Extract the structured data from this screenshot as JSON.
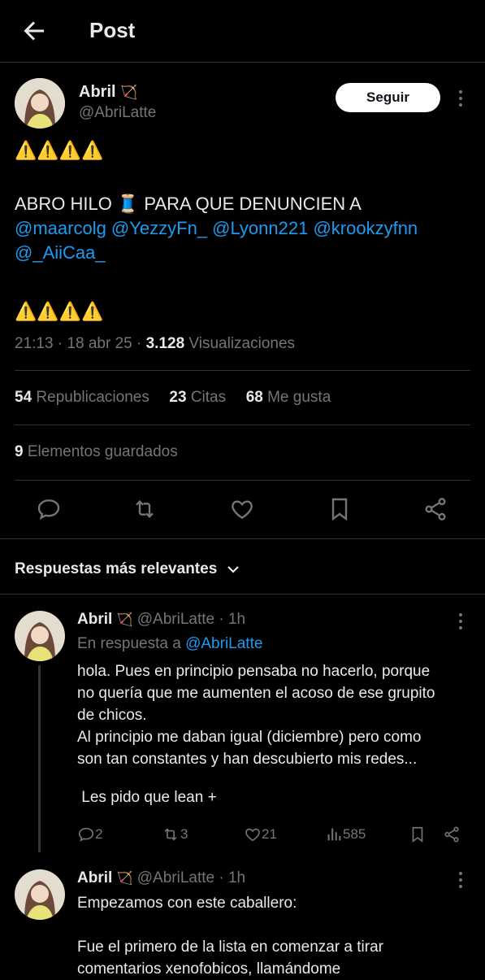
{
  "header": {
    "title": "Post"
  },
  "post": {
    "author_name": "Abril",
    "author_emoji": "🏹",
    "handle": "@AbriLatte",
    "follow_label": "Seguir",
    "warning_line_1": "⚠️⚠️⚠️⚠️",
    "text_prefix": "ABRO HILO 🧵 PARA QUE DENUNCIEN A",
    "mentions_line_1": "@maarcolg @YezzyFn_ @Lyonn221 @krookzyfnn",
    "mentions_line_2": "@_AiiCaa_",
    "warning_line_2": "⚠️⚠️⚠️⚠️",
    "timestamp": "21:13 · 18 abr 25 · ",
    "views_count": "3.128",
    "views_label": " Visualizaciones"
  },
  "stats": {
    "reposts_count": "54",
    "reposts_label": " Republicaciones",
    "quotes_count": "23",
    "quotes_label": " Citas",
    "likes_count": "68",
    "likes_label": " Me gusta",
    "saved_count": "9",
    "saved_label": " Elementos guardados"
  },
  "replies_sort": {
    "label": "Respuestas más relevantes"
  },
  "replies": [
    {
      "author_name": "Abril",
      "author_emoji": "🏹",
      "handle_time": "@AbriLatte · 1h",
      "reply_to_prefix": "En respuesta a ",
      "reply_to_handle": "@AbriLatte",
      "lines": [
        "hola. Pues en principio pensaba no hacerlo, porque",
        "no quería que me aumenten el acoso de ese grupito",
        "de chicos.",
        "Al principio me daban igual (diciembre) pero como",
        "son tan constantes y han descubierto mis redes...",
        " Les pido que lean +"
      ],
      "replies_count": "2",
      "reposts_count": "3",
      "likes_count": "21",
      "views_count": "585"
    },
    {
      "author_name": "Abril",
      "author_emoji": "🏹",
      "handle_time": "@AbriLatte · 1h",
      "lines": [
        "Empezamos con este caballero:",
        "Fue el primero de la lista en comenzar a tirar",
        "comentarios xenofobicos, llamándome"
      ]
    }
  ],
  "colors": {
    "background": "#000000",
    "text": "#e7e9ea",
    "muted": "#71767b",
    "link": "#1d9bf0",
    "divider": "#2f3336"
  }
}
